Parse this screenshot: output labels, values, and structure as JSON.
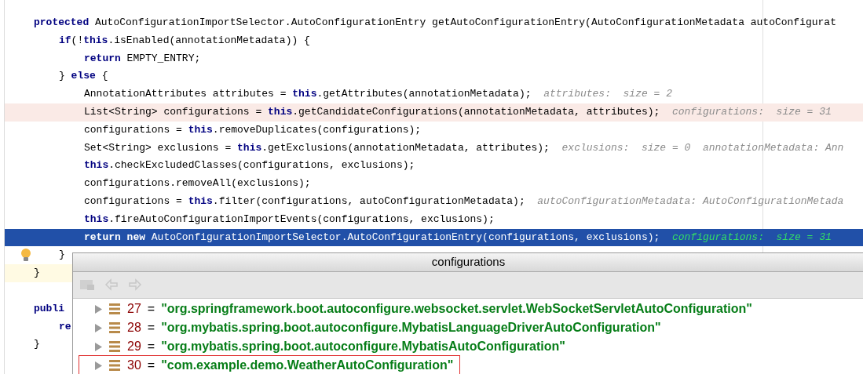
{
  "editor": {
    "lines": [
      {
        "kind": "code",
        "bulb": false,
        "segments": [
          {
            "kind": "kw",
            "text": "protected"
          },
          {
            "kind": "plain",
            "text": " AutoConfigurationImportSelector.AutoConfigurationEntry getAutoConfigurationEntry(AutoConfigurationMetadata autoConfigurat"
          }
        ],
        "children": [
          {
            "kind": "code",
            "bulb": false,
            "segments": [
              {
                "kind": "kw",
                "text": "if"
              },
              {
                "kind": "plain",
                "text": "(!"
              },
              {
                "kind": "kw",
                "text": "this"
              },
              {
                "kind": "plain",
                "text": ".isEnabled(annotationMetadata)) {"
              }
            ],
            "children": [
              {
                "kind": "code",
                "bulb": false,
                "segments": [
                  {
                    "kind": "kw",
                    "text": "return"
                  },
                  {
                    "kind": "plain",
                    "text": " EMPTY_ENTRY;"
                  }
                ]
              }
            ]
          },
          {
            "kind": "code",
            "bulb": false,
            "segments": [
              {
                "kind": "plain",
                "text": "} "
              },
              {
                "kind": "kw",
                "text": "else"
              },
              {
                "kind": "plain",
                "text": " {"
              }
            ],
            "children": [
              {
                "kind": "code",
                "bulb": false,
                "segments": [
                  {
                    "kind": "plain",
                    "text": "AnnotationAttributes attributes = "
                  },
                  {
                    "kind": "kw",
                    "text": "this"
                  },
                  {
                    "kind": "plain",
                    "text": ".getAttributes(annotationMetadata);  "
                  },
                  {
                    "kind": "hint",
                    "text": "attributes:  size = 2"
                  }
                ]
              },
              {
                "kind": "breakpoint",
                "bulb": false,
                "segments": [
                  {
                    "kind": "plain",
                    "text": "List<String> configurations = "
                  },
                  {
                    "kind": "kw",
                    "text": "this"
                  },
                  {
                    "kind": "plain",
                    "text": ".getCandidateConfigurations(annotationMetadata, attributes);  "
                  },
                  {
                    "kind": "hint",
                    "text": "configurations:  size = 31"
                  }
                ]
              },
              {
                "kind": "code",
                "bulb": false,
                "segments": [
                  {
                    "kind": "plain",
                    "text": "configurations = "
                  },
                  {
                    "kind": "kw",
                    "text": "this"
                  },
                  {
                    "kind": "plain",
                    "text": ".removeDuplicates(configurations);"
                  }
                ]
              },
              {
                "kind": "code",
                "bulb": false,
                "segments": [
                  {
                    "kind": "plain",
                    "text": "Set<String> exclusions = "
                  },
                  {
                    "kind": "kw",
                    "text": "this"
                  },
                  {
                    "kind": "plain",
                    "text": ".getExclusions(annotationMetadata, attributes);  "
                  },
                  {
                    "kind": "hint",
                    "text": "exclusions:  size = 0  annotationMetadata: Ann"
                  }
                ]
              },
              {
                "kind": "code",
                "bulb": false,
                "segments": [
                  {
                    "kind": "kw",
                    "text": "this"
                  },
                  {
                    "kind": "plain",
                    "text": ".checkExcludedClasses(configurations, exclusions);"
                  }
                ]
              },
              {
                "kind": "code",
                "bulb": false,
                "segments": [
                  {
                    "kind": "plain",
                    "text": "configurations.removeAll(exclusions);"
                  }
                ]
              },
              {
                "kind": "code",
                "bulb": false,
                "segments": [
                  {
                    "kind": "plain",
                    "text": "configurations = "
                  },
                  {
                    "kind": "kw",
                    "text": "this"
                  },
                  {
                    "kind": "plain",
                    "text": ".filter(configurations, autoConfigurationMetadata);  "
                  },
                  {
                    "kind": "hint",
                    "text": "autoConfigurationMetadata: AutoConfigurationMetada"
                  }
                ]
              },
              {
                "kind": "code",
                "bulb": false,
                "segments": [
                  {
                    "kind": "kw",
                    "text": "this"
                  },
                  {
                    "kind": "plain",
                    "text": ".fireAutoConfigurationImportEvents(configurations, exclusions);"
                  }
                ]
              },
              {
                "kind": "execution",
                "bulb": false,
                "segments": [
                  {
                    "kind": "kw",
                    "text": "return new"
                  },
                  {
                    "kind": "plain",
                    "text": " AutoConfigurationImportSelector.AutoConfigurationEntry(configurations, exclusions);  "
                  },
                  {
                    "kind": "hint",
                    "text": "configurations:  size = 31"
                  }
                ]
              }
            ]
          },
          {
            "kind": "code",
            "bulb": true,
            "segments": [
              {
                "kind": "plain",
                "text": "}"
              }
            ]
          }
        ]
      },
      {
        "kind": "caret",
        "bulb": false,
        "segments": [
          {
            "kind": "plain",
            "text": "}"
          }
        ]
      },
      {
        "kind": "code",
        "bulb": false
      },
      {
        "kind": "code",
        "bulb": false,
        "segments": [
          {
            "kind": "kw",
            "text": "publi"
          }
        ],
        "children": [
          {
            "kind": "code",
            "bulb": false,
            "segments": [
              {
                "kind": "kw",
                "text": "re"
              }
            ]
          }
        ]
      },
      {
        "kind": "code",
        "bulb": false,
        "segments": [
          {
            "kind": "plain",
            "text": "}"
          }
        ]
      }
    ]
  },
  "popup": {
    "title": "configurations",
    "rows": [
      {
        "index": "27",
        "operator": "=",
        "value": "\"org.springframework.boot.autoconfigure.websocket.servlet.WebSocketServletAutoConfiguration\"",
        "selected": false
      },
      {
        "index": "28",
        "operator": "=",
        "value": "\"org.mybatis.spring.boot.autoconfigure.MybatisLanguageDriverAutoConfiguration\"",
        "selected": false
      },
      {
        "index": "29",
        "operator": "=",
        "value": "\"org.mybatis.spring.boot.autoconfigure.MybatisAutoConfiguration\"",
        "selected": false
      },
      {
        "index": "30",
        "operator": "=",
        "value": "\"com.example.demo.WeatherAutoConfiguration\"",
        "selected": true
      }
    ]
  }
}
